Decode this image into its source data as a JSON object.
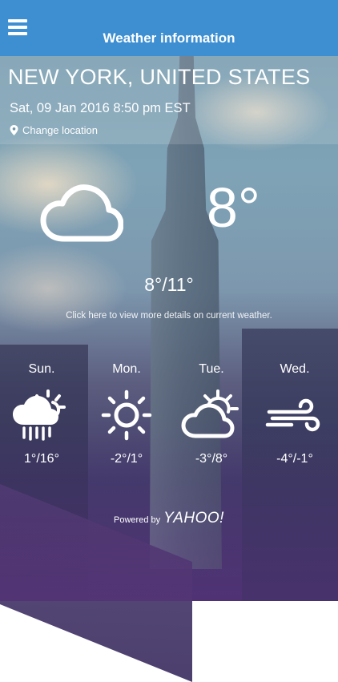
{
  "navbar": {
    "title": "Weather information",
    "menu_icon": "hamburger-menu-icon"
  },
  "location": {
    "city": "NEW YORK, UNITED STATES",
    "datetime": "Sat, 09 Jan 2016 8:50 pm EST",
    "change_label": "Change location",
    "change_icon": "location-pin-icon"
  },
  "current": {
    "condition_icon": "cloud-icon",
    "temp": "8°",
    "hilo": "8°/11°",
    "details_link": "Click here to view more details on current weather."
  },
  "forecast": [
    {
      "day": "Sun.",
      "temps": "1°/16°",
      "icon": "rain-sun-icon"
    },
    {
      "day": "Mon.",
      "temps": "-2°/1°",
      "icon": "sun-icon"
    },
    {
      "day": "Tue.",
      "temps": "-3°/8°",
      "icon": "partly-cloudy-icon"
    },
    {
      "day": "Wed.",
      "temps": "-4°/-1°",
      "icon": "wind-icon"
    }
  ],
  "footer": {
    "powered_by": "Powered by",
    "provider": "YAHOO!"
  },
  "colors": {
    "navbar": "#3d8fd1",
    "text": "#ffffff"
  }
}
